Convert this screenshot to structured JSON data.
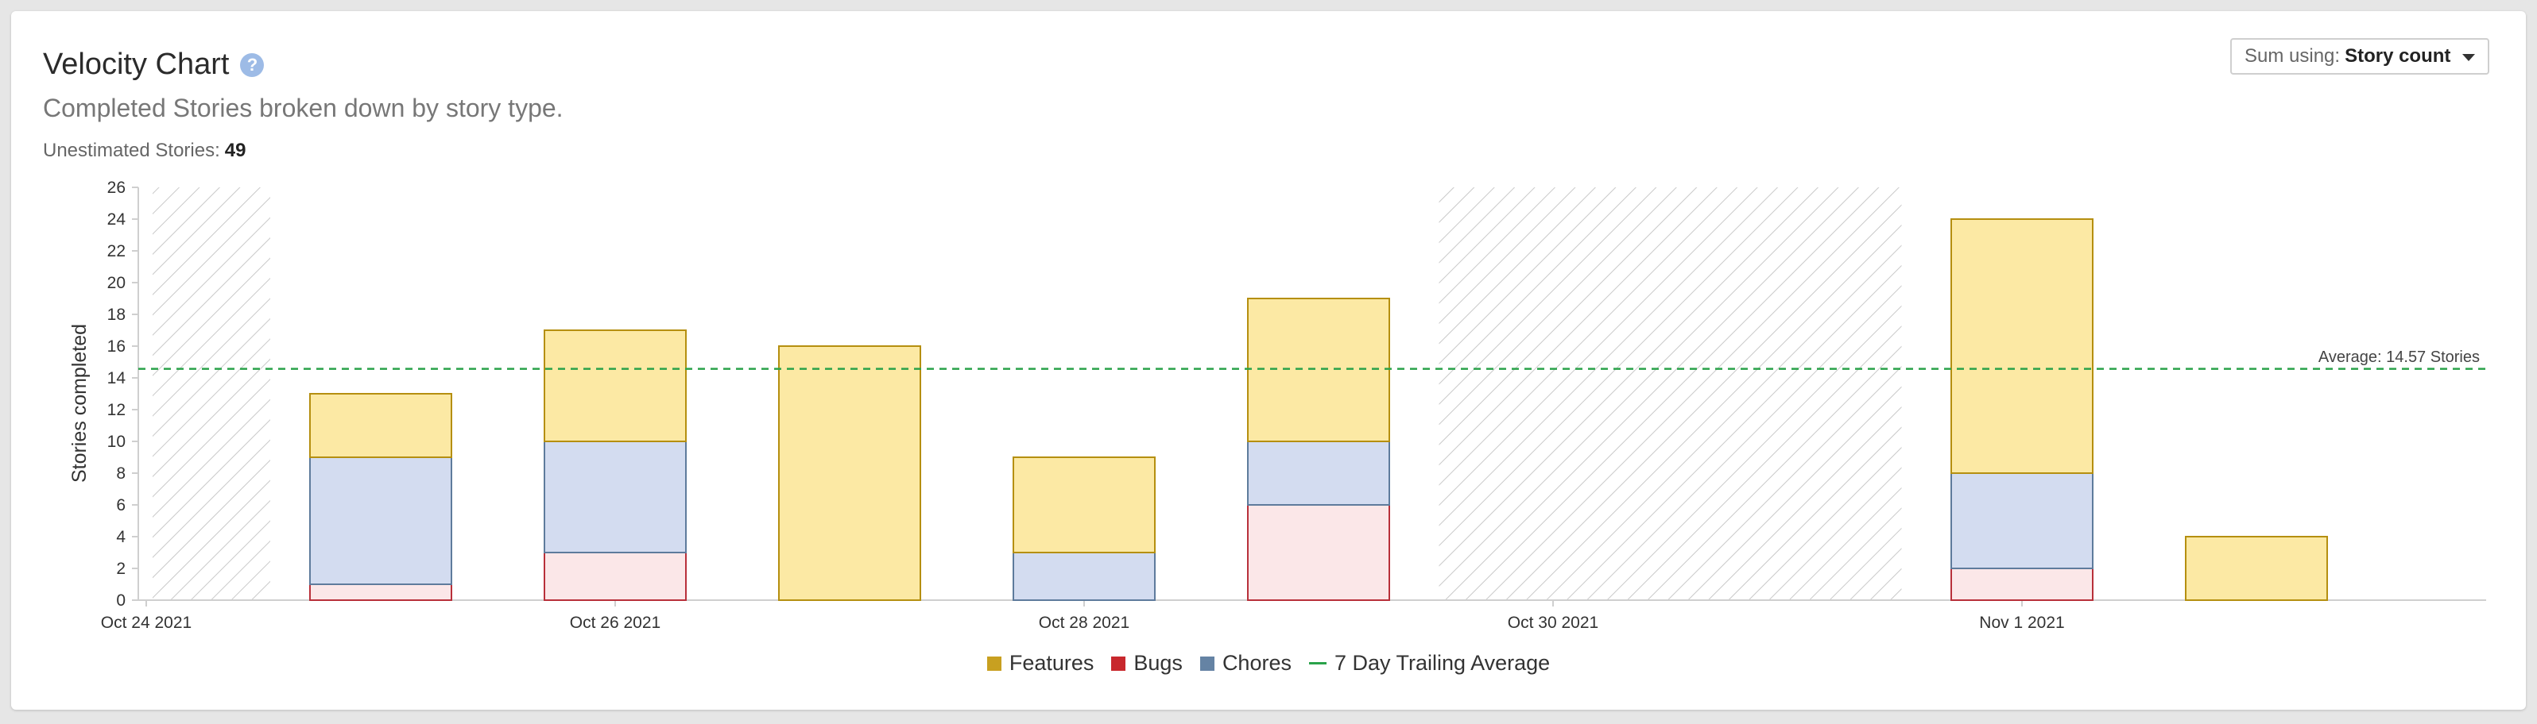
{
  "header": {
    "title": "Velocity Chart",
    "help_icon": "question-circle-icon",
    "subtitle": "Completed Stories broken down by story type.",
    "unestimated_label": "Unestimated Stories:",
    "unestimated_value": "49"
  },
  "sum_select": {
    "label": "Sum using:",
    "value": "Story count",
    "icon": "chevron-down-icon"
  },
  "colors": {
    "features_fill": "#fce9a4",
    "features_stroke": "#b58f10",
    "bugs_fill": "#fbe7e8",
    "bugs_stroke": "#b8303a",
    "chores_fill": "#d3dcf0",
    "chores_stroke": "#5e7b9c",
    "average_line": "#2aa24a",
    "legend_features": "#c8a020",
    "legend_bugs": "#c8282d",
    "legend_chores": "#6583a4"
  },
  "legend": {
    "features": "Features",
    "bugs": "Bugs",
    "chores": "Chores",
    "average": "7 Day Trailing Average"
  },
  "chart_data": {
    "type": "bar",
    "stacked": true,
    "ylabel": "Stories completed",
    "xlabel": "",
    "ylim": [
      0,
      26
    ],
    "y_ticks": [
      0,
      2,
      4,
      6,
      8,
      10,
      12,
      14,
      16,
      18,
      20,
      22,
      24,
      26
    ],
    "x_tick_labels": [
      "Oct 24 2021",
      "Oct 26 2021",
      "Oct 28 2021",
      "Oct 30 2021",
      "Nov 1 2021"
    ],
    "categories": [
      "Oct 24",
      "Oct 25",
      "Oct 26",
      "Oct 27",
      "Oct 28",
      "Oct 29",
      "Oct 30",
      "Oct 31",
      "Nov 1",
      "Nov 2"
    ],
    "non_working_days": [
      "Oct 24",
      "Oct 30",
      "Oct 31"
    ],
    "series": [
      {
        "name": "Bugs",
        "values": [
          0,
          1,
          3,
          0,
          0,
          6,
          0,
          0,
          2,
          0
        ]
      },
      {
        "name": "Chores",
        "values": [
          0,
          8,
          7,
          0,
          3,
          4,
          0,
          0,
          6,
          0
        ]
      },
      {
        "name": "Features",
        "values": [
          0,
          4,
          7,
          16,
          6,
          9,
          0,
          0,
          16,
          4
        ]
      }
    ],
    "average": {
      "value": 14.57,
      "label": "Average: 14.57 Stories"
    }
  }
}
